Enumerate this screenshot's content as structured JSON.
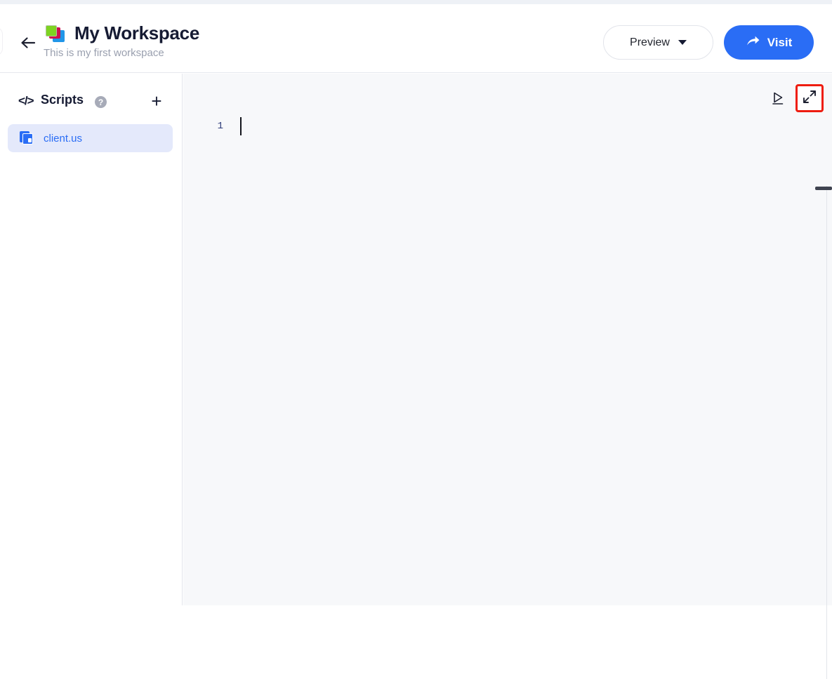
{
  "header": {
    "back_icon": "arrow-left-icon",
    "workspace_icon": "stacked-squares-icon",
    "title": "My Workspace",
    "subtitle": "This is my first workspace",
    "preview_label": "Preview",
    "preview_caret_icon": "chevron-down-icon",
    "visit_label": "Visit",
    "visit_icon": "arrow-share-icon",
    "accent_blue": "#2a6df5"
  },
  "sidebar": {
    "code_icon": "</>",
    "section_label": "Scripts",
    "help_icon": "?",
    "add_icon": "+",
    "files": [
      {
        "name": "client.us",
        "icon": "file-copy-icon",
        "selected": true,
        "selected_bg": "#e4e9fb",
        "text_color": "#2a6df5"
      }
    ]
  },
  "editor": {
    "run_icon": "play-run-icon",
    "expand_icon": "expand-diagonal-icon",
    "expand_highlight_color": "#ee1d10",
    "line_numbers": [
      "1"
    ],
    "content": "",
    "background": "#f7f8fa",
    "scrollbar": {
      "thumb_color": "#3f4350",
      "track_color": "#e2e5ea"
    }
  }
}
